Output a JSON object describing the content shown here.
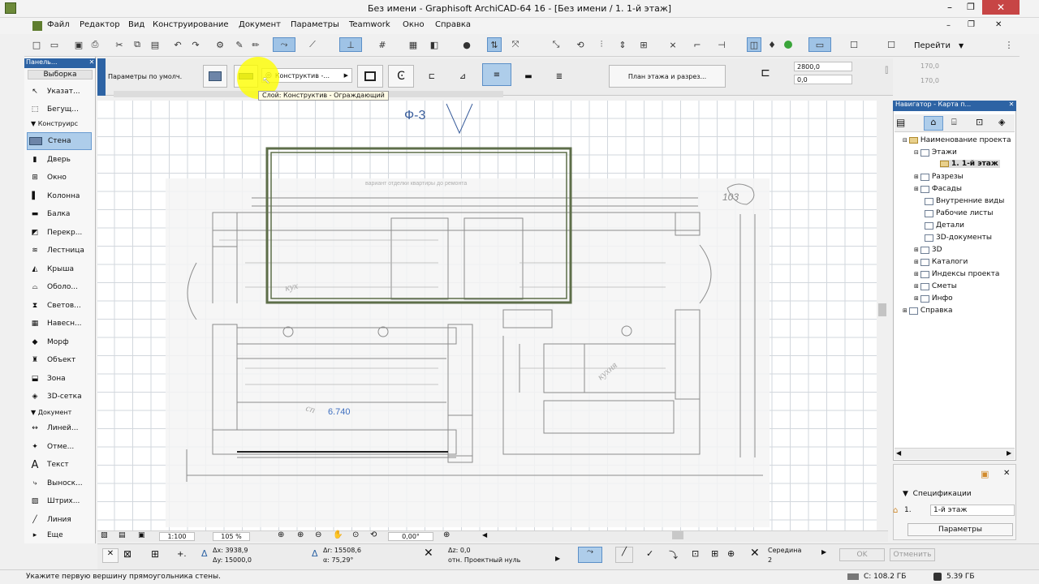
{
  "window": {
    "title": "Без имени - Graphisoft ArchiCAD-64 16 - [Без имени / 1. 1-й этаж]"
  },
  "menu": [
    "Файл",
    "Редактор",
    "Вид",
    "Конструирование",
    "Документ",
    "Параметры",
    "Teamwork",
    "Окно",
    "Справка"
  ],
  "toolbox": {
    "header": "Панель...",
    "select_label": "Выборка",
    "pointer": "Указат...",
    "marquee": "Бегущ...",
    "section_design": "Конструирс",
    "tools": [
      "Стена",
      "Дверь",
      "Окно",
      "Колонна",
      "Балка",
      "Перекр...",
      "Лестница",
      "Крыша",
      "Оболо...",
      "Светов...",
      "Навесн...",
      "Морф",
      "Объект",
      "Зона",
      "3D-сетка"
    ],
    "section_doc": "Документ",
    "doc_tools": [
      "Линей...",
      "Отме...",
      "Текст",
      "Выноск...",
      "Штрих...",
      "Линия"
    ],
    "more": "Еще"
  },
  "infobox": {
    "default_params": "Параметры по умолч.",
    "layer": "Конструктив -...",
    "tooltip": "Слой: Конструктив - Ограждающий",
    "floorplan_btn": "План этажа и разрез...",
    "height_val": "2800,0",
    "offset_val": "0,0",
    "right_val1": "170,0",
    "right_val2": "170,0"
  },
  "toolbar": {
    "goto_label": "Перейти"
  },
  "canvas": {
    "label_f3": "Ф-3",
    "sketch_number": "103",
    "sketch_title": "вариант отделки квартиры до ремонта",
    "dimension_text": "6.740",
    "room_labels": [
      "кух",
      "сп",
      "кухня"
    ]
  },
  "navigator": {
    "header": "Навигатор - Карта п...",
    "items": [
      {
        "label": "Наименование проекта",
        "level": 0
      },
      {
        "label": "Этажи",
        "level": 1
      },
      {
        "label": "1. 1-й этаж",
        "level": 2
      },
      {
        "label": "Разрезы",
        "level": 1
      },
      {
        "label": "Фасады",
        "level": 1
      },
      {
        "label": "Внутренние виды",
        "level": 1
      },
      {
        "label": "Рабочие листы",
        "level": 1
      },
      {
        "label": "Детали",
        "level": 1
      },
      {
        "label": "3D-документы",
        "level": 1
      },
      {
        "label": "3D",
        "level": 1
      },
      {
        "label": "Каталоги",
        "level": 1
      },
      {
        "label": "Индексы проекта",
        "level": 1
      },
      {
        "label": "Сметы",
        "level": 1
      },
      {
        "label": "Инфо",
        "level": 1
      },
      {
        "label": "Справка",
        "level": 0
      }
    ]
  },
  "specs": {
    "title": "Спецификации",
    "floor_num": "1.",
    "floor_name": "1-й этаж",
    "params_btn": "Параметры"
  },
  "bottom_toolbar": {
    "scale": "1:100",
    "zoom": "105 %",
    "angle": "0,00°"
  },
  "coords": {
    "dx": "Δx: 3938,9",
    "dy": "Δy: 15000,0",
    "dr": "Δr: 15508,6",
    "da": "α: 75,29°",
    "dz": "Δz: 0,0",
    "ref": "отн. Проектный нуль",
    "middle": "Середина",
    "middle_n": "2",
    "ok": "OK",
    "cancel": "Отменить"
  },
  "status": {
    "hint": "Укажите первую вершину прямоугольника стены.",
    "disk_c": "C: 108.2 ГБ",
    "mem": "5.39 ГБ"
  },
  "colors": {
    "accent": "#2d63a4",
    "selection": "#aecdea",
    "wall_frame": "#4b5e3a",
    "highlight": "#ffff00"
  }
}
